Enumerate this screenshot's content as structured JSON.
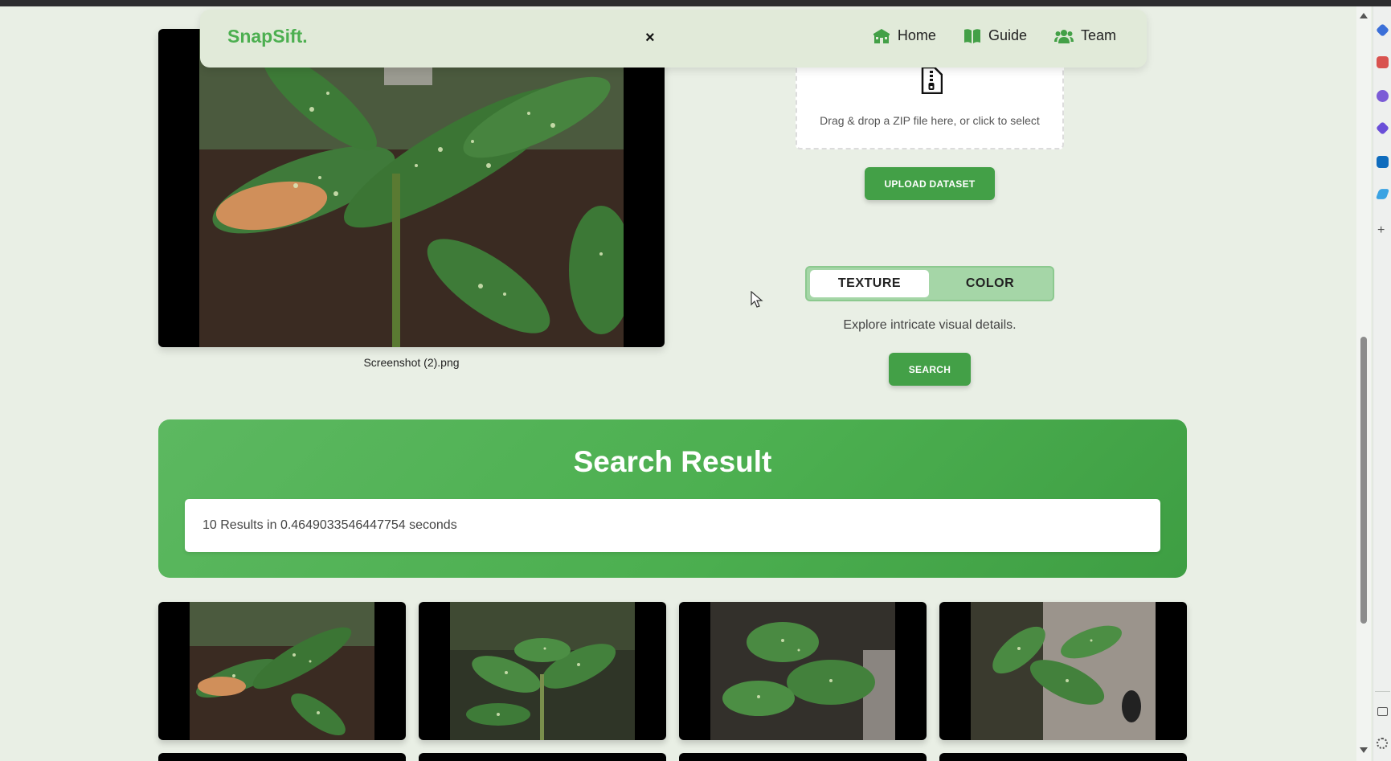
{
  "navbar": {
    "brand": "SnapSift.",
    "close_label": "×",
    "links": [
      {
        "label": "Home",
        "icon": "school-icon"
      },
      {
        "label": "Guide",
        "icon": "book-icon"
      },
      {
        "label": "Team",
        "icon": "users-icon"
      }
    ]
  },
  "query": {
    "caption": "Screenshot (2).png"
  },
  "upload": {
    "drop_text": "Drag & drop a ZIP file here, or click to select",
    "button_label": "UPLOAD DATASET"
  },
  "mode_toggle": {
    "options": [
      "TEXTURE",
      "COLOR"
    ],
    "selected": "TEXTURE",
    "description": "Explore intricate visual details."
  },
  "search": {
    "button_label": "SEARCH"
  },
  "results": {
    "title": "Search Result",
    "summary": "10 Results in 0.4649033546447754 seconds"
  },
  "colors": {
    "accent": "#4caf50",
    "button": "#43a047",
    "page_bg": "#e9efe5",
    "navbar_bg": "#e1ead9",
    "toggle_bg": "#a5d6a7"
  }
}
